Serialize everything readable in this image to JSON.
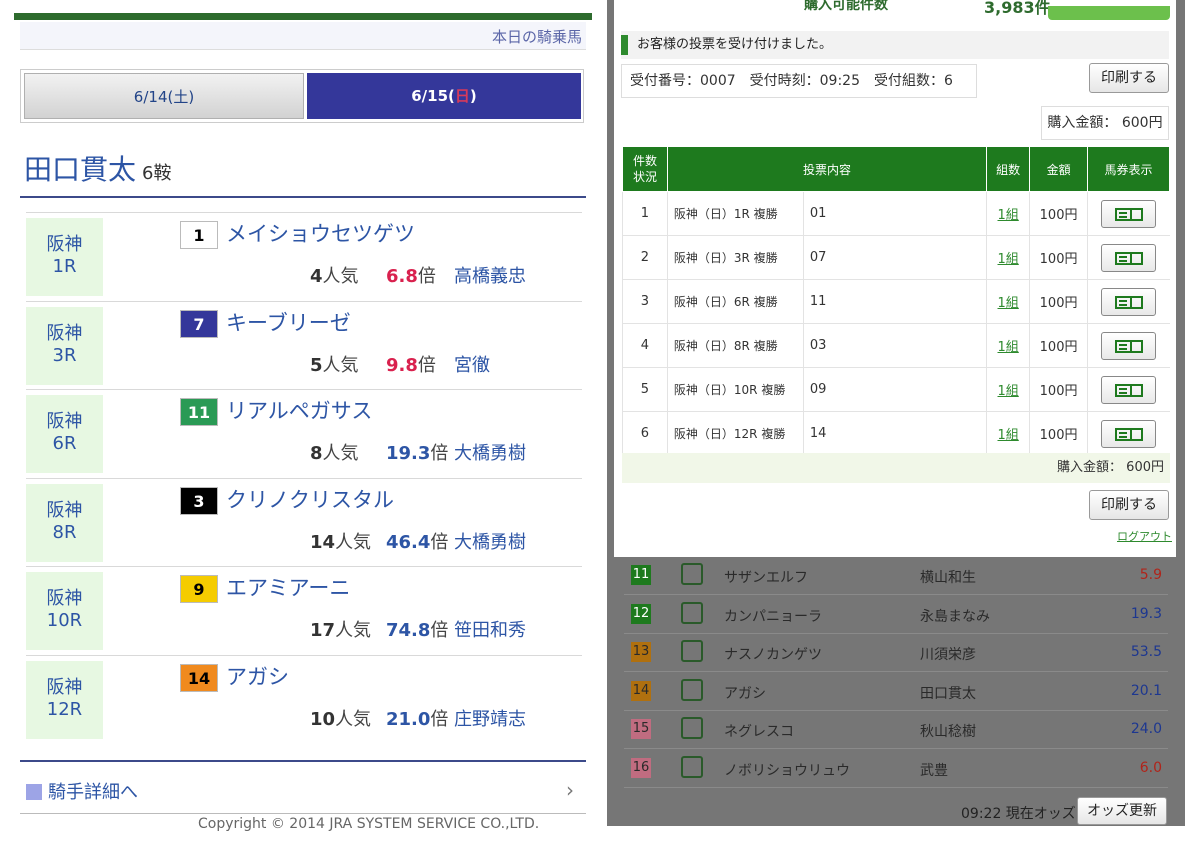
{
  "left": {
    "header_link": "本日の騎乗馬",
    "tabs": [
      {
        "label_pre": "6/14(土)",
        "label_day": "",
        "label_post": ""
      },
      {
        "label_pre": "6/15(",
        "label_day": "日",
        "label_post": ")"
      }
    ],
    "jockey": {
      "name": "田口貫太",
      "rides": "6鞍"
    },
    "races": [
      {
        "venue": "阪神",
        "race": "1R",
        "num": "1",
        "horse": "メイショウセツゲツ",
        "pop": "4",
        "pop_suffix": "人気",
        "odds": "6.8",
        "odds_suffix": "倍",
        "odds_color": "red",
        "jockey": "高橋義忠",
        "box_bg": "#ffffff",
        "box_fg": "#000000"
      },
      {
        "venue": "阪神",
        "race": "3R",
        "num": "7",
        "horse": "キーブリーゼ",
        "pop": "5",
        "pop_suffix": "人気",
        "odds": "9.8",
        "odds_suffix": "倍",
        "odds_color": "red",
        "jockey": "宮徹",
        "box_bg": "#34379a",
        "box_fg": "#ffffff"
      },
      {
        "venue": "阪神",
        "race": "6R",
        "num": "11",
        "horse": "リアルペガサス",
        "pop": "8",
        "pop_suffix": "人気",
        "odds": "19.3",
        "odds_suffix": "倍",
        "odds_color": "blue",
        "jockey": "大橋勇樹",
        "box_bg": "#2a9a55",
        "box_fg": "#ffffff"
      },
      {
        "venue": "阪神",
        "race": "8R",
        "num": "3",
        "horse": "クリノクリスタル",
        "pop": "14",
        "pop_suffix": "人気",
        "odds": "46.4",
        "odds_suffix": "倍",
        "odds_color": "blue",
        "jockey": "大橋勇樹",
        "box_bg": "#000000",
        "box_fg": "#ffffff"
      },
      {
        "venue": "阪神",
        "race": "10R",
        "num": "9",
        "horse": "エアミアーニ",
        "pop": "17",
        "pop_suffix": "人気",
        "odds": "74.8",
        "odds_suffix": "倍",
        "odds_color": "blue",
        "jockey": "笹田和秀",
        "box_bg": "#f5cc00",
        "box_fg": "#000000"
      },
      {
        "venue": "阪神",
        "race": "12R",
        "num": "14",
        "horse": "アガシ",
        "pop": "10",
        "pop_suffix": "人気",
        "odds": "21.0",
        "odds_suffix": "倍",
        "odds_color": "blue",
        "jockey": "庄野靖志",
        "box_bg": "#f08a1e",
        "box_fg": "#000000"
      }
    ],
    "detail_link": "騎手詳細へ",
    "copyright": "Copyright © 2014 JRA SYSTEM SERVICE CO.,LTD."
  },
  "right": {
    "top_hint": "購入可能件数",
    "top_hint_value": "3,983件",
    "notice": "お客様の投票を受け付けました。",
    "receipt": "受付番号：0007　受付時刻：09:25　受付組数：6",
    "print_label": "印刷する",
    "purchase_amount": "購入金額：  600円",
    "table_headers": [
      "件数\n状況",
      "投票内容",
      "組数",
      "金額",
      "馬券表示"
    ],
    "bets": [
      {
        "no": "1",
        "content": "阪神（日）1R 複勝",
        "sel": "01",
        "kumi": "1組",
        "amount": "100円"
      },
      {
        "no": "2",
        "content": "阪神（日）3R 複勝",
        "sel": "07",
        "kumi": "1組",
        "amount": "100円"
      },
      {
        "no": "3",
        "content": "阪神（日）6R 複勝",
        "sel": "11",
        "kumi": "1組",
        "amount": "100円"
      },
      {
        "no": "4",
        "content": "阪神（日）8R 複勝",
        "sel": "03",
        "kumi": "1組",
        "amount": "100円"
      },
      {
        "no": "5",
        "content": "阪神（日）10R 複勝",
        "sel": "09",
        "kumi": "1組",
        "amount": "100円"
      },
      {
        "no": "6",
        "content": "阪神（日）12R 複勝",
        "sel": "14",
        "kumi": "1組",
        "amount": "100円"
      }
    ],
    "total_label": "購入金額：  600円",
    "logout": "ログアウト",
    "odds_rows": [
      {
        "num": "11",
        "horse": "サザンエルフ",
        "jockey": "横山和生",
        "odds": "5.9",
        "num_bg": "#1e7a1e",
        "num_fg": "#ffffff",
        "odds_color": "#b0241a"
      },
      {
        "num": "12",
        "horse": "カンパニョーラ",
        "jockey": "永島まなみ",
        "odds": "19.3",
        "num_bg": "#1e7a1e",
        "num_fg": "#ffffff",
        "odds_color": "#1d3790"
      },
      {
        "num": "13",
        "horse": "ナスノカンゲツ",
        "jockey": "川須栄彦",
        "odds": "53.5",
        "num_bg": "#b0700f",
        "num_fg": "#2a2a2a",
        "odds_color": "#1d3790"
      },
      {
        "num": "14",
        "horse": "アガシ",
        "jockey": "田口貫太",
        "odds": "20.1",
        "num_bg": "#b0700f",
        "num_fg": "#2a2a2a",
        "odds_color": "#1d3790"
      },
      {
        "num": "15",
        "horse": "ネグレスコ",
        "jockey": "秋山稔樹",
        "odds": "24.0",
        "num_bg": "#c06c80",
        "num_fg": "#2a2a2a",
        "odds_color": "#1d3790"
      },
      {
        "num": "16",
        "horse": "ノボリショウリュウ",
        "jockey": "武豊",
        "odds": "6.0",
        "num_bg": "#c06c80",
        "num_fg": "#2a2a2a",
        "odds_color": "#b0241a"
      }
    ],
    "odds_time": "09:22 現在オッズ",
    "odds_update": "オッズ更新"
  }
}
